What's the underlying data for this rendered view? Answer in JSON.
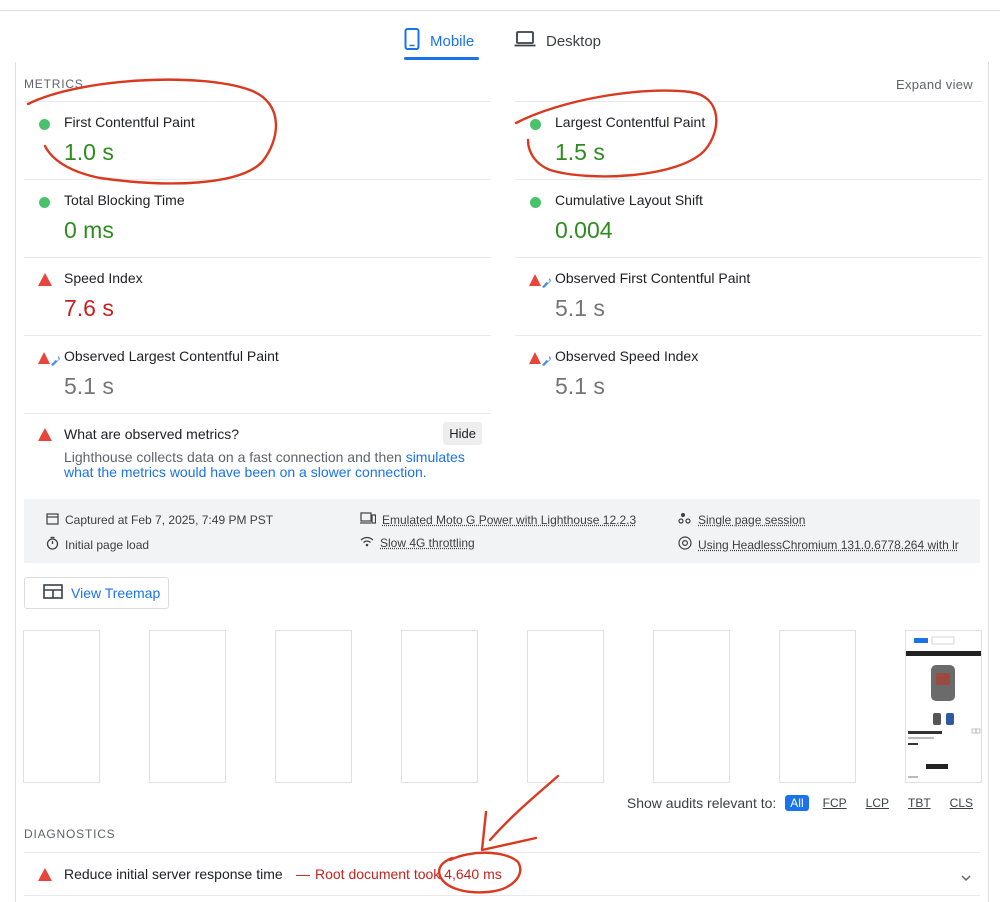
{
  "tabs": [
    {
      "label": "Mobile",
      "active": true,
      "icon": "phone-icon"
    },
    {
      "label": "Desktop",
      "active": false,
      "icon": "laptop-icon"
    }
  ],
  "metrics": {
    "title": "METRICS",
    "expand_label": "Expand view",
    "items": [
      {
        "name": "First Contentful Paint",
        "value": "1.0 s",
        "status": "pass"
      },
      {
        "name": "Largest Contentful Paint",
        "value": "1.5 s",
        "status": "pass"
      },
      {
        "name": "Total Blocking Time",
        "value": "0 ms",
        "status": "pass"
      },
      {
        "name": "Cumulative Layout Shift",
        "value": "0.004",
        "status": "pass"
      },
      {
        "name": "Speed Index",
        "value": "7.6 s",
        "status": "fail"
      },
      {
        "name": "Observed First Contentful Paint",
        "value": "5.1 s",
        "status": "observed"
      },
      {
        "name": "Observed Largest Contentful Paint",
        "value": "5.1 s",
        "status": "observed"
      },
      {
        "name": "Observed Speed Index",
        "value": "5.1 s",
        "status": "observed"
      }
    ],
    "observed_info": {
      "title": "What are observed metrics?",
      "hide_label": "Hide",
      "desc_prefix": "Lighthouse collects data on a fast connection and then ",
      "desc_link": "simulates what the metrics would have been on a slower connection."
    }
  },
  "info_bar": {
    "captured": "Captured at Feb 7, 2025, 7:49 PM PST",
    "initial_load": "Initial page load",
    "device": "Emulated Moto G Power with Lighthouse 12.2.3",
    "throttling": "Slow 4G throttling",
    "session": "Single page session",
    "browser": "Using HeadlessChromium 131.0.6778.264 with lr"
  },
  "treemap_label": "View Treemap",
  "filmstrip": {
    "frames": 8
  },
  "audit_filter": {
    "label": "Show audits relevant to:",
    "chips": [
      "All",
      "FCP",
      "LCP",
      "TBT",
      "CLS"
    ],
    "active": "All"
  },
  "diagnostics": {
    "title": "DIAGNOSTICS",
    "items": [
      {
        "title": "Reduce initial server response time",
        "separator": "—",
        "detail": "Root document took 4,640 ms"
      }
    ]
  },
  "colors": {
    "pass": "#2e8b1f",
    "fail": "#c5221f",
    "observed": "#757575",
    "accent": "#1a73e8",
    "annotation": "#d93a1f"
  }
}
